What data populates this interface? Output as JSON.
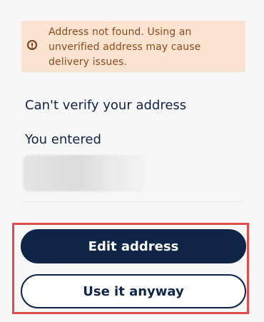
{
  "warning": {
    "message": "Address not found. Using an unverified address may cause delivery issues.",
    "icon": "warning-circle-icon",
    "colors": {
      "background": "#fbe4cf",
      "text": "#8a4a1f"
    }
  },
  "verification": {
    "title": "Can't verify your address",
    "entered_label": "You entered"
  },
  "actions": {
    "edit_label": "Edit address",
    "use_label": "Use it anyway"
  },
  "colors": {
    "primary": "#0f2547",
    "highlight": "#e34b4b"
  }
}
